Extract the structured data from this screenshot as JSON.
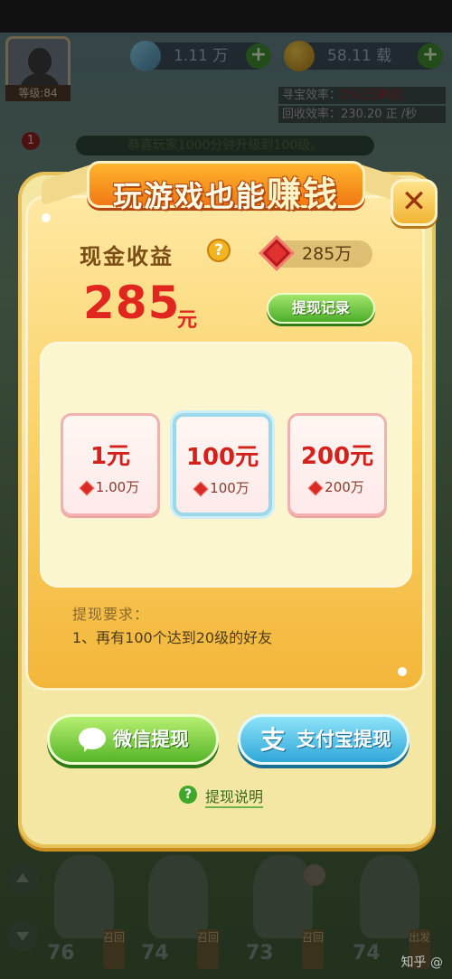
{
  "player": {
    "level_label": "等级:84"
  },
  "resources": {
    "gems": "1.11 万",
    "coins": "58.11 载"
  },
  "stats": {
    "treasure_rate_label": "寻宝效率：",
    "treasure_rate_value": "1%(已满级)",
    "recycle_rate_label": "回收效率：",
    "recycle_rate_value": "230.20 正 /秒"
  },
  "notice": "恭喜玩家1000分钟升级到100级。",
  "notice_badge": "1",
  "dialog": {
    "banner_part1": "玩游戏也能",
    "banner_part2": "赚钱",
    "close_symbol": "✕",
    "cash_label": "现金收益",
    "help_symbol": "?",
    "gem_balance": "285万",
    "amount": "285",
    "amount_unit": "元",
    "record_button": "提现记录",
    "options": [
      {
        "value": "1元",
        "cost": "1.00万",
        "selected": false
      },
      {
        "value": "100元",
        "cost": "100万",
        "selected": true
      },
      {
        "value": "200元",
        "cost": "200万",
        "selected": false
      }
    ],
    "requirements_title": "提现要求：",
    "requirements": [
      "1、再有100个达到20级的好友"
    ],
    "wechat_button": "微信提现",
    "alipay_button": "支付宝提现",
    "alipay_icon_glyph": "支",
    "explain_link": "提现说明",
    "explain_symbol": "?"
  },
  "animals": [
    {
      "level": "76",
      "tag": "召回"
    },
    {
      "level": "74",
      "tag": "召回"
    },
    {
      "level": "73",
      "tag": "召回"
    },
    {
      "level": "74",
      "tag": "出发"
    }
  ],
  "watermark": "知乎 @",
  "icons": [
    "avatar-silhouette",
    "gem-icon",
    "coin-icon",
    "plus-icon",
    "close-icon",
    "help-icon",
    "ruby-icon",
    "wechat-icon",
    "alipay-icon",
    "arrow-up-icon",
    "arrow-down-icon"
  ],
  "colors": {
    "accent_red": "#e0261f",
    "green_button": "#56b52a",
    "blue_button": "#2fa7d8",
    "panel": "#fbd46b"
  }
}
